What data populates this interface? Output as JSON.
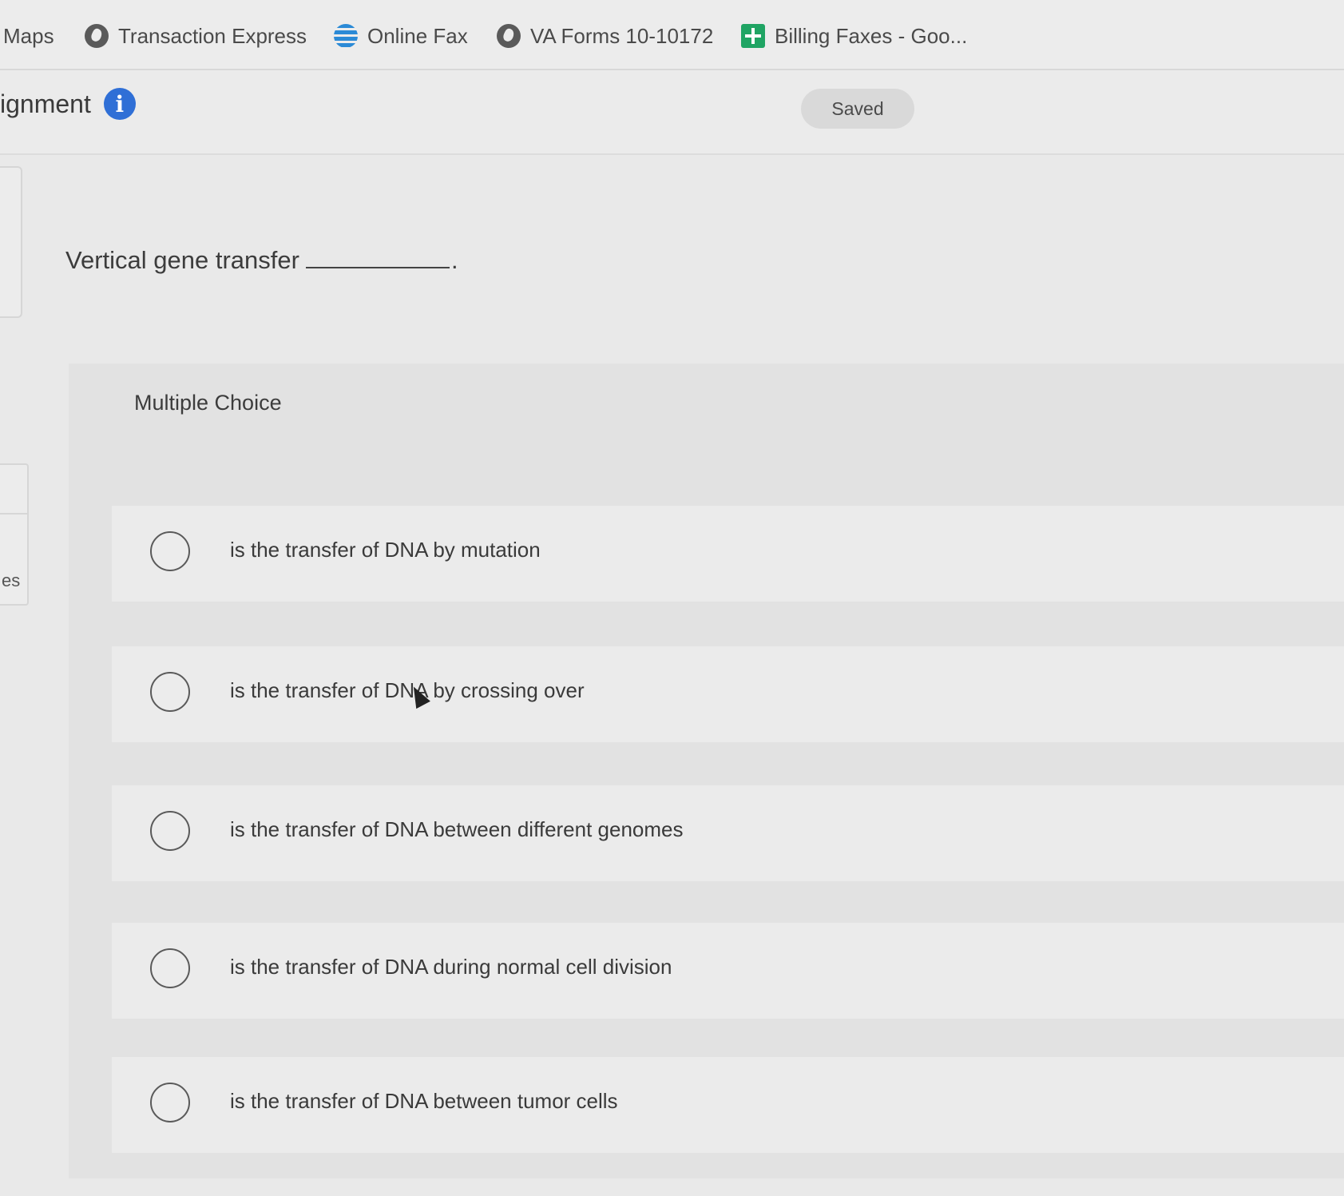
{
  "bookmarks": [
    {
      "label": "Maps",
      "icon": "none"
    },
    {
      "label": "Transaction Express",
      "icon": "globe-icon"
    },
    {
      "label": "Online Fax",
      "icon": "att-globe-icon"
    },
    {
      "label": "VA Forms 10-10172",
      "icon": "globe-icon"
    },
    {
      "label": "Billing Faxes - Goo...",
      "icon": "sheets-plus-icon"
    }
  ],
  "header": {
    "title": "ignment",
    "info_icon": "i",
    "saved_label": "Saved"
  },
  "sidebar_fragment": {
    "text": "es"
  },
  "question": {
    "text": "Vertical gene transfer",
    "end_punct": "."
  },
  "multiple_choice": {
    "label": "Multiple Choice",
    "options": [
      {
        "text": "is the transfer of DNA by mutation"
      },
      {
        "text": "is the transfer of DNA by crossing over"
      },
      {
        "text": "is the transfer of DNA between different genomes"
      },
      {
        "text": "is the transfer of DNA during normal cell division"
      },
      {
        "text": "is the transfer of DNA between tumor cells"
      }
    ]
  }
}
